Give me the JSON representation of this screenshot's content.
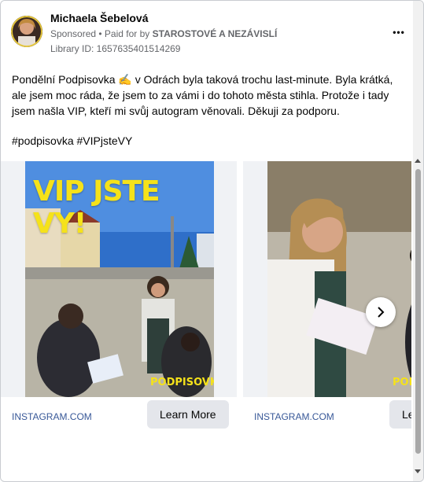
{
  "post": {
    "page_name": "Michaela Šebelová",
    "sponsored": "Sponsored",
    "paid_prefix": " • Paid for by ",
    "paid_by": "STAROSTOVÉ A NEZÁVISLÍ",
    "library_id": "Library ID: 1657635401514269",
    "more_label": "•••",
    "body": "Pondělní Podpisovka ✍️ v Odrách byla taková trochu last-minute. Byla krátká, ale jsem moc ráda, že jsem to za vámi i do tohoto města stihla. Protože i tady jsem našla VIP, kteří mi svůj autogram věnovali. Děkuji za podporu.",
    "hashtags": "#podpisovka #VIPjsteVY"
  },
  "carousel": {
    "cards": [
      {
        "overlay_title": "VIP JSTE VY!",
        "badge": "PODPISOVKA",
        "domain": "INSTAGRAM.COM",
        "cta": "Learn More"
      },
      {
        "badge": "PODPISOVKA",
        "domain": "INSTAGRAM.COM",
        "cta": "Learn More"
      }
    ],
    "next_icon": "chevron-right-icon"
  }
}
